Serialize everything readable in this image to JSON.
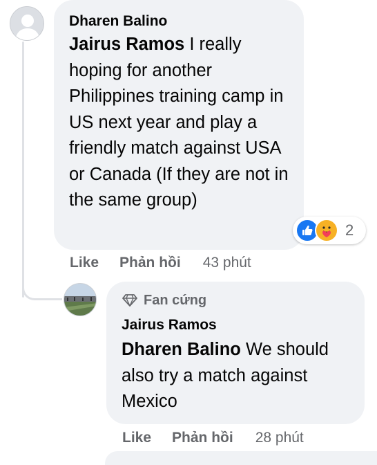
{
  "comment": {
    "author": "Dharen Balino",
    "mention": "Jairus Ramos",
    "text": " I really hoping for another Philippines training camp in US next year and play a friendly match against USA or Canada (If they are not in the same group)",
    "reaction_count": "2",
    "reactions": [
      "like-icon",
      "care-icon"
    ],
    "actions": {
      "like": "Like",
      "reply": "Phản hồi",
      "time": "43 phút"
    }
  },
  "reply": {
    "badge": "Fan cứng",
    "author": "Jairus Ramos",
    "mention": "Dharen Balino",
    "text": " We should also try a match against Mexico",
    "actions": {
      "like": "Like",
      "reply": "Phản hồi",
      "time": "28 phút"
    }
  },
  "colors": {
    "bubble": "#f0f2f5",
    "secondary_text": "#65676b",
    "like_blue": "#1877f2",
    "care_yellow": "#f7b125"
  }
}
